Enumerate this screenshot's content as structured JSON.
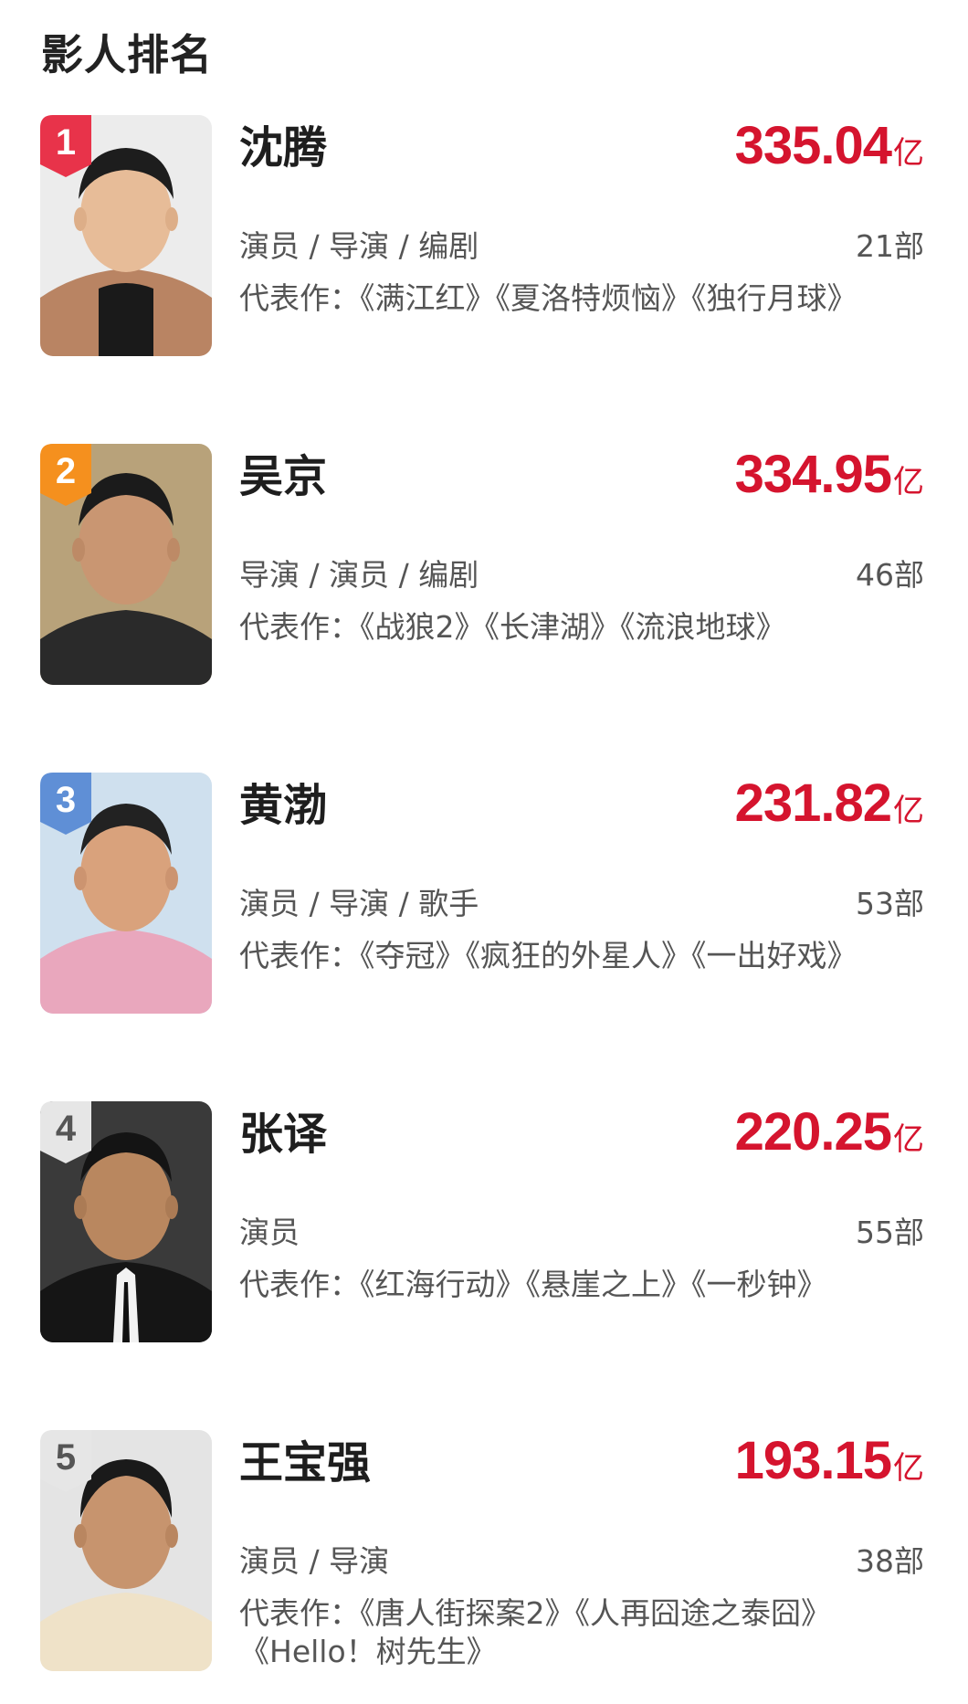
{
  "page": {
    "title": "影人排名"
  },
  "ranking": [
    {
      "rank": "1",
      "badge_color": "#e8334a",
      "name": "沈腾",
      "box_office": "335.04",
      "unit": "亿",
      "roles": "演员 / 导演 / 编剧",
      "film_count": "21部",
      "works": "代表作：《满江红》《夏洛特烦恼》《独行月球》"
    },
    {
      "rank": "2",
      "badge_color": "#f5901e",
      "name": "吴京",
      "box_office": "334.95",
      "unit": "亿",
      "roles": "导演 / 演员 / 编剧",
      "film_count": "46部",
      "works": "代表作：《战狼2》《长津湖》《流浪地球》"
    },
    {
      "rank": "3",
      "badge_color": "#5f8fd6",
      "name": "黄渤",
      "box_office": "231.82",
      "unit": "亿",
      "roles": "演员 / 导演 / 歌手",
      "film_count": "53部",
      "works": "代表作：《夺冠》《疯狂的外星人》《一出好戏》"
    },
    {
      "rank": "4",
      "badge_color": "#e6e6e6",
      "name": "张译",
      "box_office": "220.25",
      "unit": "亿",
      "roles": "演员",
      "film_count": "55部",
      "works": "代表作：《红海行动》《悬崖之上》《一秒钟》"
    },
    {
      "rank": "5",
      "badge_color": "#e6e6e6",
      "name": "王宝强",
      "box_office": "193.15",
      "unit": "亿",
      "roles": "演员 / 导演",
      "film_count": "38部",
      "works": "代表作：《唐人街探案2》《人再囧途之泰囧》《Hello！树先生》"
    }
  ]
}
